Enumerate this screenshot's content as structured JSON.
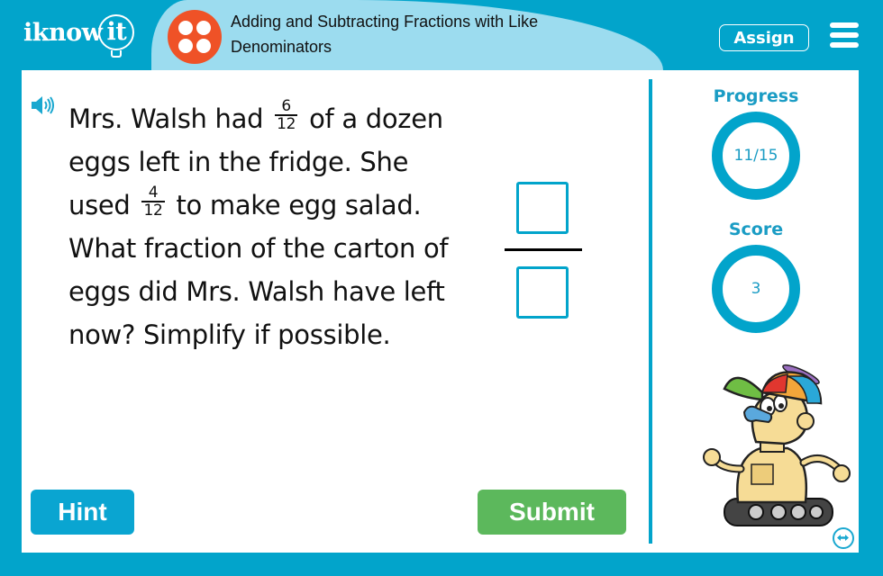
{
  "header": {
    "logo_text": "iknow",
    "logo_bulb_text": "it",
    "lesson_title": "Adding and Subtracting Fractions with Like Denominators",
    "assign_label": "Assign",
    "topic_icon": "four-dots-icon",
    "menu_icon": "hamburger-menu-icon"
  },
  "question": {
    "speaker_icon": "speaker-icon",
    "part1": "Mrs. Walsh had",
    "frac1": {
      "numerator": "6",
      "denominator": "12"
    },
    "part2": "of a dozen eggs left in the fridge. She used",
    "frac2": {
      "numerator": "4",
      "denominator": "12"
    },
    "part3": "to make egg salad. What fraction of the carton of eggs did Mrs. Walsh have left now? Simplify if possible."
  },
  "answer": {
    "numerator_value": "",
    "denominator_value": ""
  },
  "sidebar": {
    "progress_label": "Progress",
    "progress_value": "11/15",
    "score_label": "Score",
    "score_value": "3"
  },
  "buttons": {
    "hint_label": "Hint",
    "submit_label": "Submit"
  },
  "colors": {
    "brand": "#02a4cb",
    "title_band": "#9cdcef",
    "topic_icon": "#ef5227",
    "submit": "#5cb85c"
  }
}
